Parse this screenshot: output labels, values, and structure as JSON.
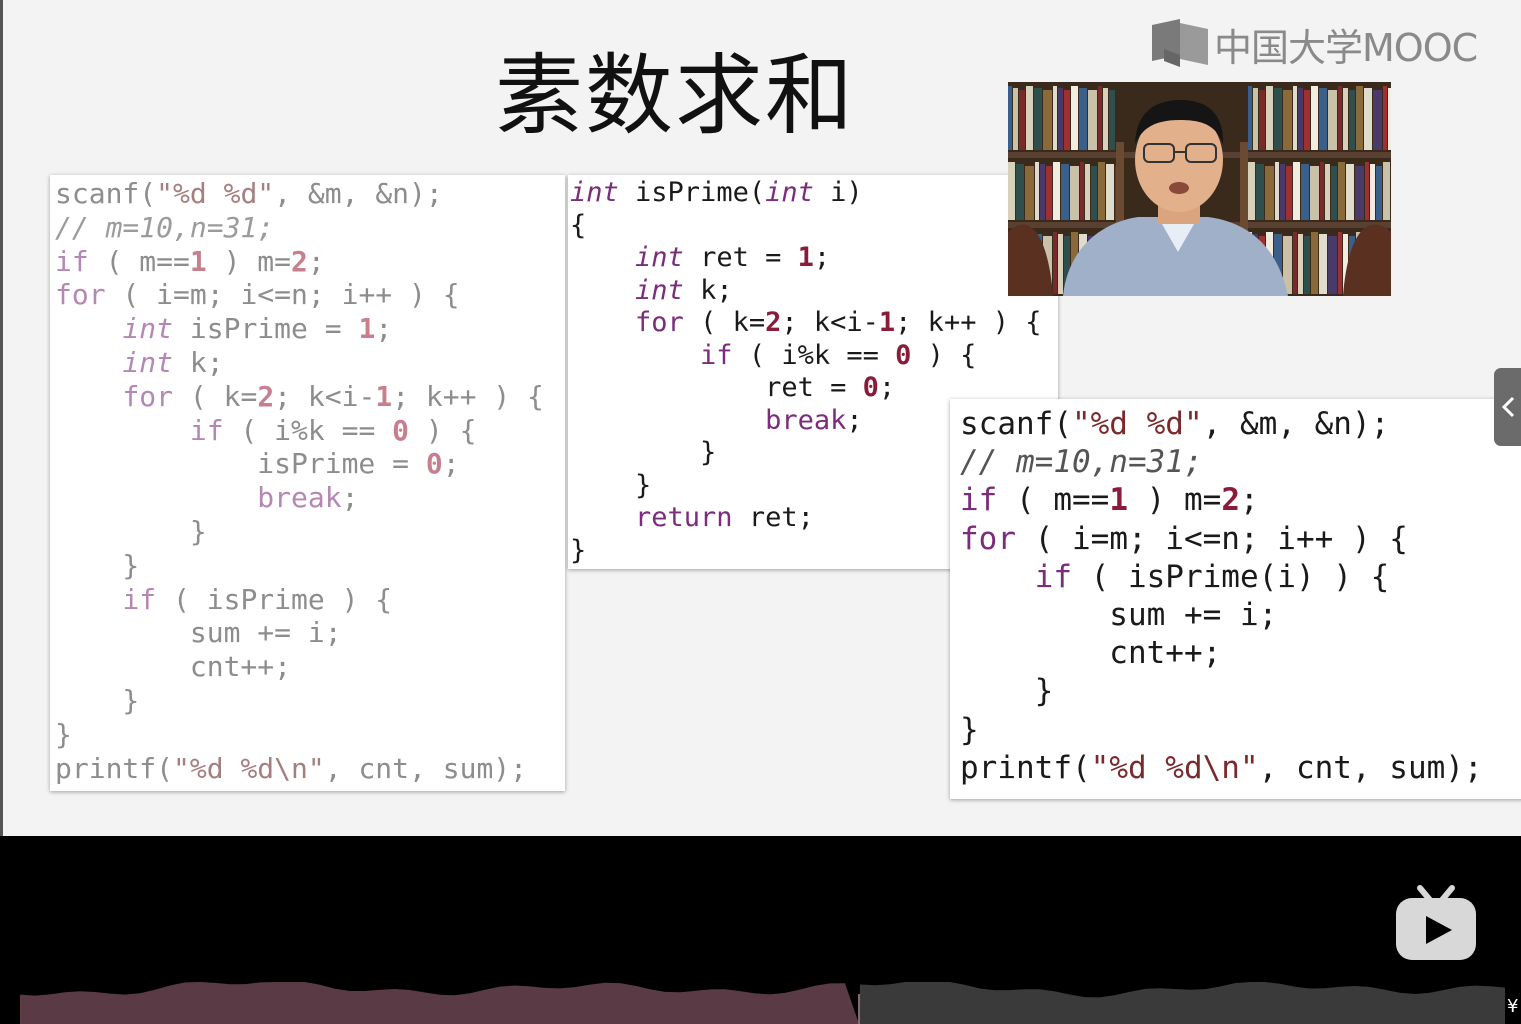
{
  "slide": {
    "title": "素数求和",
    "logo_text": "中国大学MOOC"
  },
  "code_left": [
    "scanf(\"%d %d\", &m, &n);",
    "// m=10,n=31;",
    "if ( m==1 ) m=2;",
    "for ( i=m; i<=n; i++ ) {",
    "    int isPrime = 1;",
    "    int k;",
    "    for ( k=2; k<i-1; k++ ) {",
    "        if ( i%k == 0 ) {",
    "            isPrime = 0;",
    "            break;",
    "        }",
    "    }",
    "    if ( isPrime ) {",
    "        sum += i;",
    "        cnt++;",
    "    }",
    "}",
    "printf(\"%d %d\\n\", cnt, sum);"
  ],
  "code_mid": [
    "int isPrime(int i)",
    "{",
    "    int ret = 1;",
    "    int k;",
    "    for ( k=2; k<i-1; k++ ) {",
    "        if ( i%k == 0 ) {",
    "            ret = 0;",
    "            break;",
    "        }",
    "    }",
    "    return ret;",
    "}"
  ],
  "code_right": [
    "scanf(\"%d %d\", &m, &n);",
    "// m=10,n=31;",
    "if ( m==1 ) m=2;",
    "for ( i=m; i<=n; i++ ) {",
    "    if ( isPrime(i) ) {",
    "        sum += i;",
    "        cnt++;",
    "    }",
    "}",
    "printf(\"%d %d\\n\", cnt, sum);"
  ],
  "player": {
    "progress_fraction": 0.565,
    "corner_glyph": "¥"
  },
  "icons": {
    "logo": "mooc-logo-icon",
    "side_tab": "chevron-left-icon",
    "play": "bilibili-tv-icon"
  },
  "colors": {
    "keyword": "#7b2c7b",
    "number": "#8a1c3a",
    "played": "#5a3a44",
    "unplayed": "#3a3a3a"
  }
}
